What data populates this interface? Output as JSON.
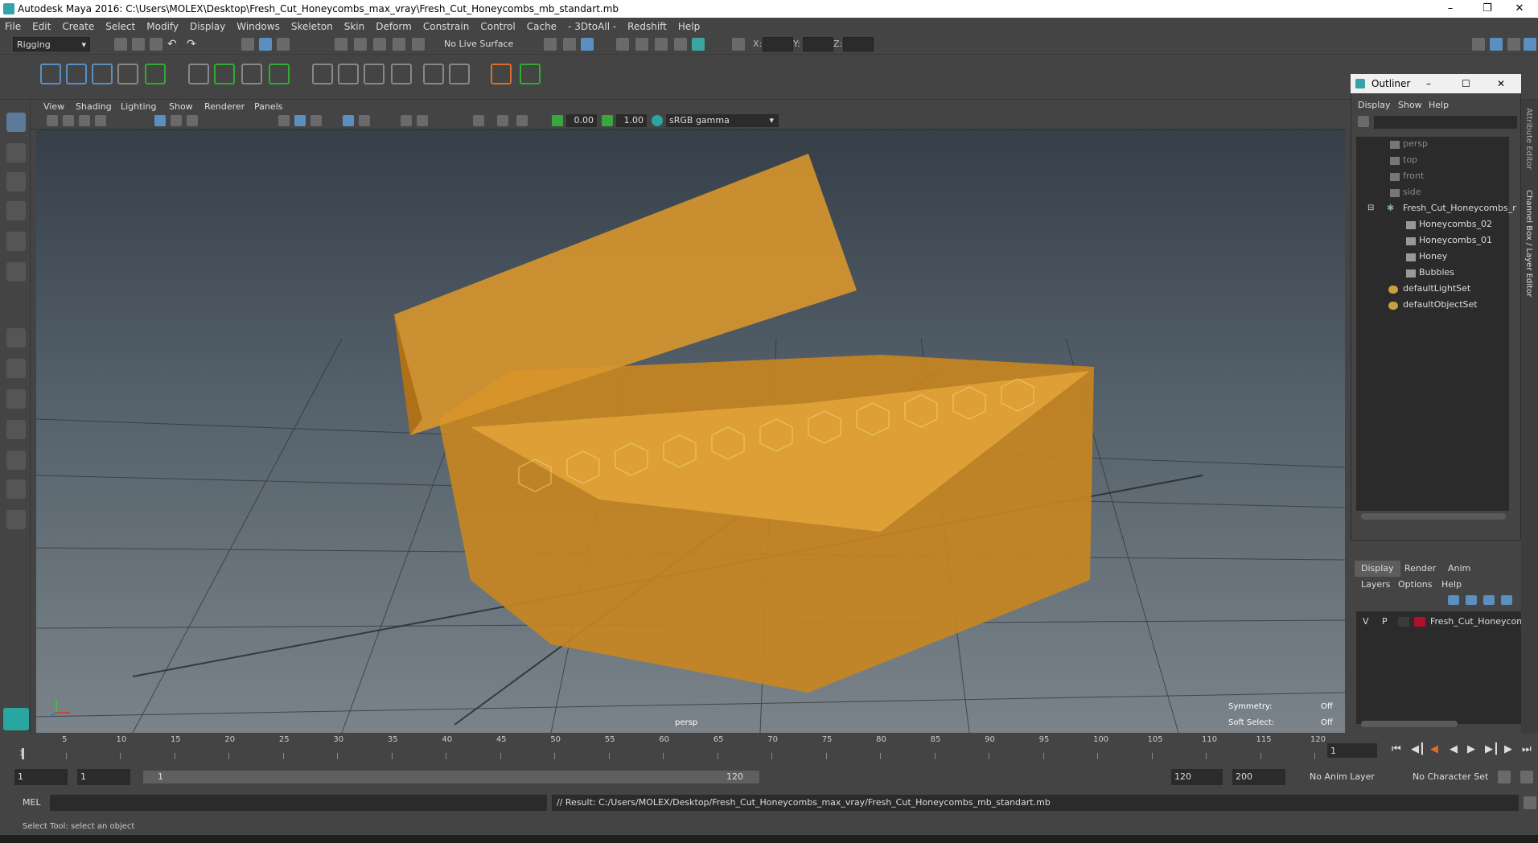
{
  "window": {
    "title": "Autodesk Maya 2016: C:\\Users\\MOLEX\\Desktop\\Fresh_Cut_Honeycombs_max_vray\\Fresh_Cut_Honeycombs_mb_standart.mb"
  },
  "menubar": [
    "File",
    "Edit",
    "Create",
    "Select",
    "Modify",
    "Display",
    "Windows",
    "Skeleton",
    "Skin",
    "Deform",
    "Constrain",
    "Control",
    "Cache",
    "- 3DtoAll -",
    "Redshift",
    "Help"
  ],
  "status": {
    "mode": "Rigging",
    "live_surface": "No Live Surface",
    "x_label": "X:",
    "y_label": "Y:",
    "z_label": "Z:"
  },
  "viewport": {
    "menus": [
      "View",
      "Shading",
      "Lighting",
      "Show",
      "Renderer",
      "Panels"
    ],
    "exposure": "0.00",
    "gamma_value": "1.00",
    "color_space": "sRGB gamma",
    "camera_label": "persp",
    "symmetry_label": "Symmetry:",
    "symmetry_value": "Off",
    "soft_select_label": "Soft Select:",
    "soft_select_value": "Off"
  },
  "outliner": {
    "title": "Outliner",
    "menus": [
      "Display",
      "Show",
      "Help"
    ],
    "items": [
      {
        "label": "persp",
        "dim": true
      },
      {
        "label": "top",
        "dim": true
      },
      {
        "label": "front",
        "dim": true
      },
      {
        "label": "side",
        "dim": true
      },
      {
        "label": "Fresh_Cut_Honeycombs_r",
        "dim": false
      },
      {
        "label": "Honeycombs_02",
        "dim": false
      },
      {
        "label": "Honeycombs_01",
        "dim": false
      },
      {
        "label": "Honey",
        "dim": false
      },
      {
        "label": "Bubbles",
        "dim": false
      },
      {
        "label": "defaultLightSet",
        "dim": false
      },
      {
        "label": "defaultObjectSet",
        "dim": false
      }
    ]
  },
  "layers": {
    "tabs": [
      "Display",
      "Render",
      "Anim"
    ],
    "menus": [
      "Layers",
      "Options",
      "Help"
    ],
    "row": {
      "v": "V",
      "p": "P",
      "name": "Fresh_Cut_Honeycomb",
      "color": "#b0102a"
    }
  },
  "right_strip": {
    "labels": [
      "Attribute Editor",
      "Channel Box / Layer Editor"
    ]
  },
  "timeline": {
    "ticks": [
      "5",
      "10",
      "15",
      "20",
      "25",
      "30",
      "35",
      "40",
      "45",
      "50",
      "55",
      "60",
      "65",
      "70",
      "75",
      "80",
      "85",
      "90",
      "95",
      "100",
      "105",
      "110",
      "115",
      "120"
    ],
    "start_marker": "1",
    "current_frame": "1"
  },
  "range": {
    "start": "1",
    "playback_start": "1",
    "slider_start": "1",
    "slider_end": "120",
    "playback_end": "120",
    "end": "200",
    "anim_layer": "No Anim Layer",
    "character_set": "No Character Set"
  },
  "command": {
    "lang": "MEL",
    "result": "// Result: C:/Users/MOLEX/Desktop/Fresh_Cut_Honeycombs_max_vray/Fresh_Cut_Honeycombs_mb_standart.mb"
  },
  "help_line": "Select Tool: select an object"
}
